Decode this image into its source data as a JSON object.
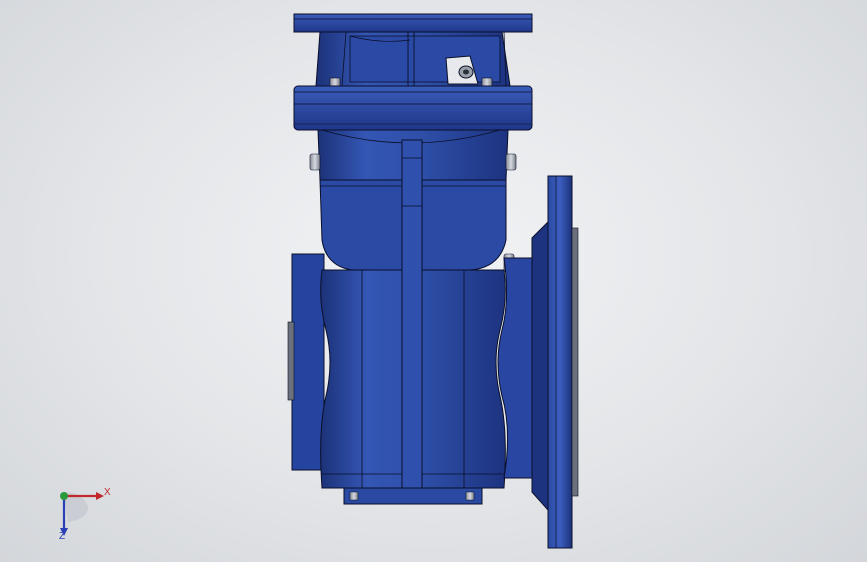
{
  "viewport": {
    "background_top": "#eef0f2",
    "background_bottom": "#d3d6da"
  },
  "model": {
    "name": "gear-reducer",
    "body_color": "#2e4fa8",
    "body_dark": "#1c3278",
    "body_light": "#4a6cc8",
    "edge_color": "#0a0f2a",
    "bolt_color": "#b8bcc6"
  },
  "triad": {
    "x_label": "X",
    "z_label": "Z",
    "x_color": "#c0282c",
    "y_color": "#2a9a3a",
    "z_color": "#2b3fb5"
  }
}
